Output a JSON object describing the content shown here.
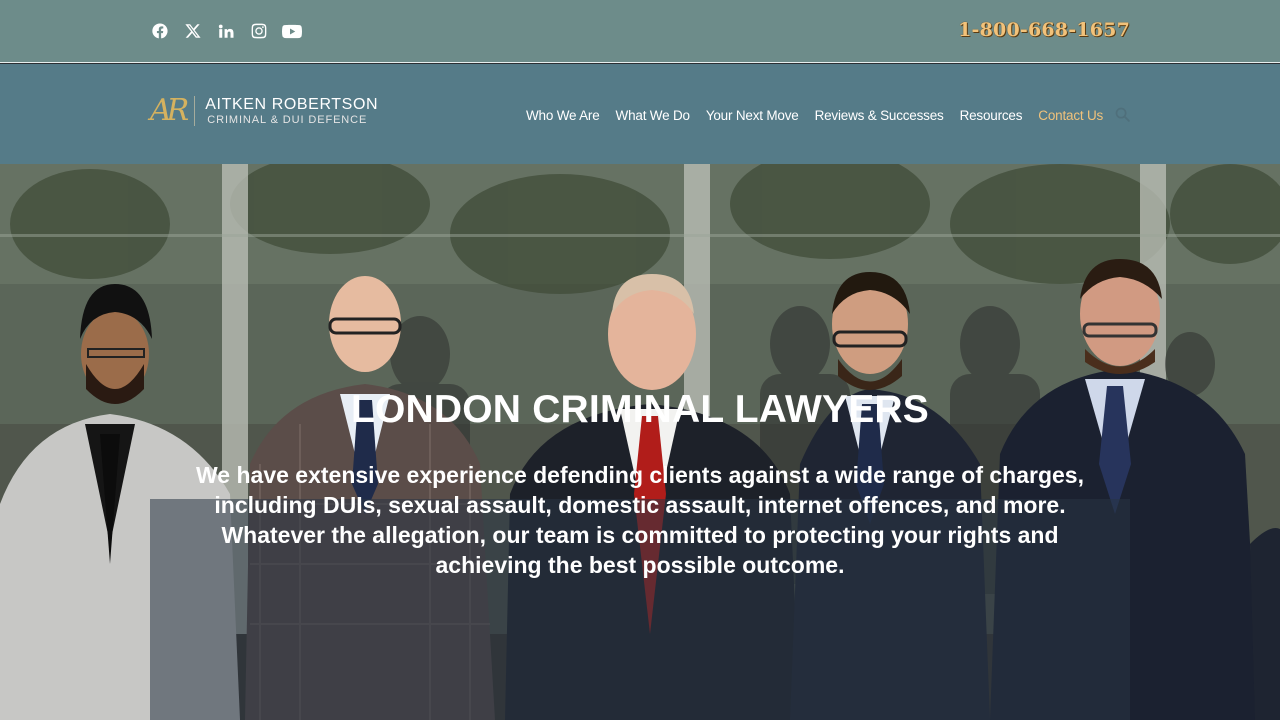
{
  "topbar": {
    "social": [
      "facebook-icon",
      "x-icon",
      "linkedin-icon",
      "instagram-icon",
      "youtube-icon"
    ],
    "phone": "1-800-668-1657"
  },
  "logo": {
    "mark": "AR",
    "name": "AITKEN ROBERTSON",
    "tagline": "CRIMINAL & DUI DEFENCE"
  },
  "nav": {
    "items": [
      "Who We Are",
      "What We Do",
      "Your Next Move",
      "Reviews & Successes",
      "Resources",
      "Contact Us"
    ],
    "active": "Contact Us",
    "search_icon": "search-icon"
  },
  "hero": {
    "title": "LONDON CRIMINAL LAWYERS",
    "text": "We have extensive experience defending clients against a wide range of charges, including DUIs, sexual assault, domestic assault, internet offences, and more. Whatever the allegation, our team is committed to protecting your rights and achieving the best possible outcome."
  },
  "colors": {
    "topbar": "#6d8c8a",
    "navbar": "#557b88",
    "accent": "#f0c27b",
    "phone": "#f2c27a"
  }
}
